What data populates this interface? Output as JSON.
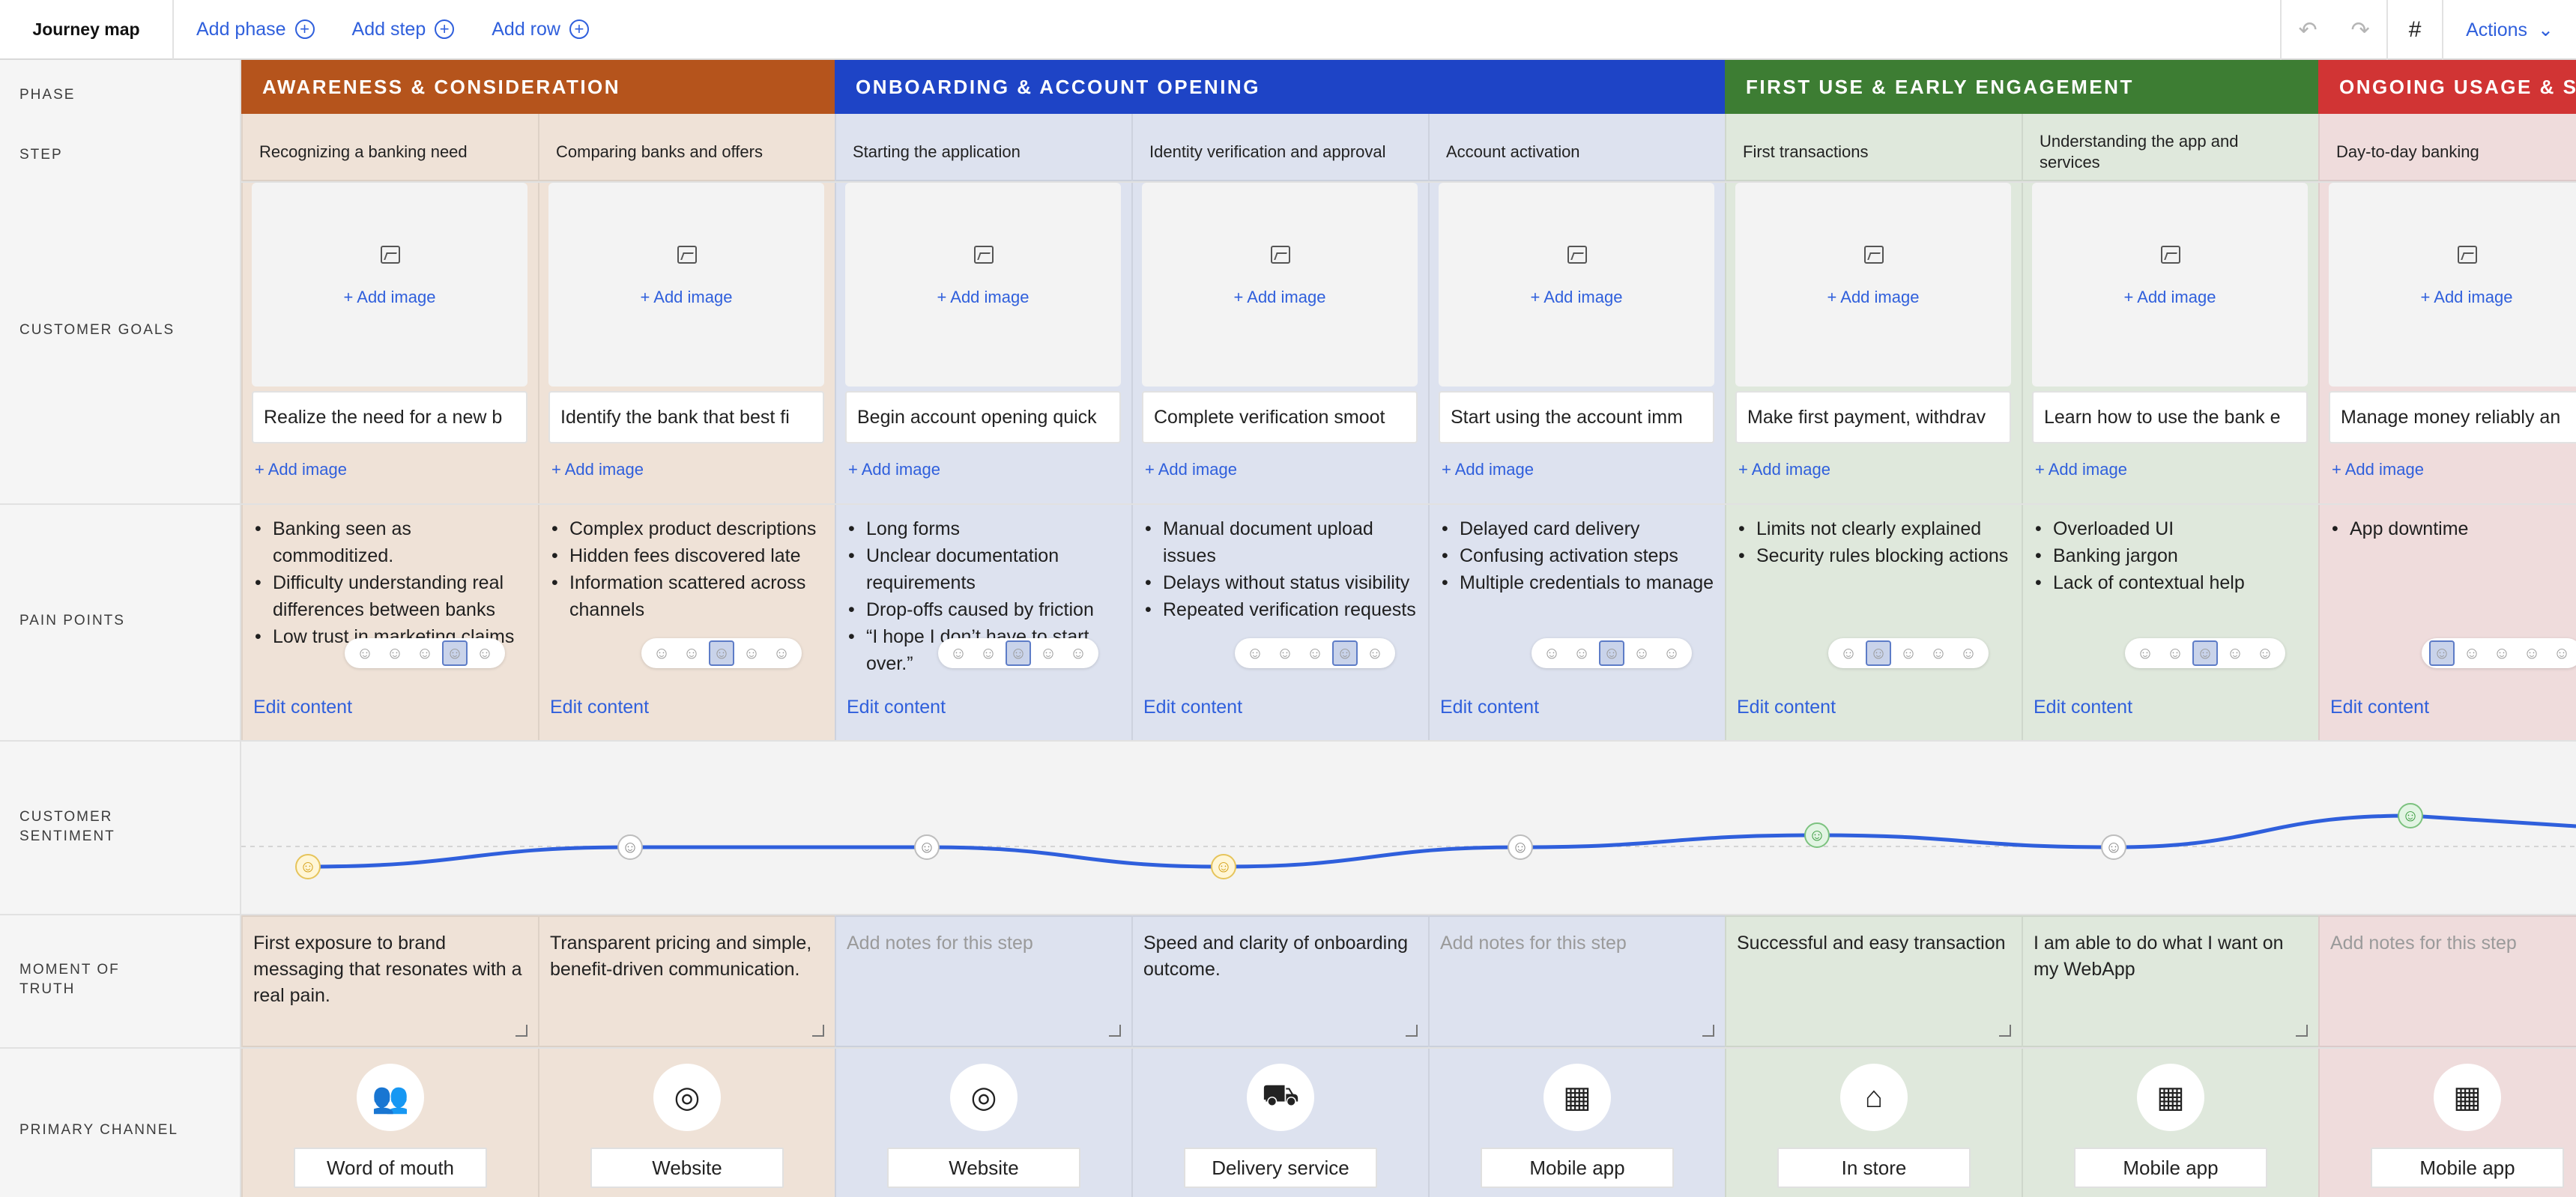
{
  "toolbar": {
    "title": "Journey map",
    "add_phase": "Add phase",
    "add_step": "Add step",
    "add_row": "Add row",
    "actions": "Actions"
  },
  "row_labels": {
    "phase": "PHASE",
    "step": "STEP",
    "customer_goals": "CUSTOMER GOALS",
    "pain_points": "PAIN POINTS",
    "customer_sentiment": "CUSTOMER SENTIMENT",
    "moment_of_truth": "MOMENT OF TRUTH",
    "primary_channel": "PRIMARY CHANNEL"
  },
  "phases": [
    {
      "name": "AWARENESS & CONSIDERATION",
      "color": "#b5541c"
    },
    {
      "name": "ONBOARDING & ACCOUNT OPENING",
      "color": "#1e44c6"
    },
    {
      "name": "FIRST USE & EARLY ENGAGEMENT",
      "color": "#3d7d33"
    },
    {
      "name": "ONGOING USAGE & SU",
      "color": "#d13434"
    }
  ],
  "common": {
    "add_image": "+ Add image",
    "edit_content": "Edit content"
  },
  "steps": [
    {
      "title": "Recognizing a banking need",
      "tint": "#efe2d7",
      "goal": "Realize the need for a new b",
      "pains": [
        "Banking seen as commoditized.",
        "Difficulty understanding real differences between banks",
        "Low trust in marketing claims"
      ],
      "moment": "First exposure to brand messaging that resonates with a real pain.",
      "moment_placeholder": false,
      "sentiment": "neutral-low",
      "channel_icon": "people-icon",
      "channel": "Word of mouth"
    },
    {
      "title": "Comparing banks and offers",
      "tint": "#efe2d7",
      "goal": "Identify the bank that best fi",
      "pains": [
        "Complex product descriptions",
        "Hidden fees discovered late",
        "Information scattered across channels"
      ],
      "moment": "Transparent pricing and simple, benefit-driven communication.",
      "moment_placeholder": false,
      "sentiment": "neutral",
      "channel_icon": "globe-icon",
      "channel": "Website"
    },
    {
      "title": "Starting the application",
      "tint": "#dde2ef",
      "goal": "Begin account opening quick",
      "pains": [
        "Long forms",
        "Unclear documentation requirements",
        "Drop-offs caused by friction",
        "“I hope I don’t have to start over.”"
      ],
      "moment": "Add notes for this step",
      "moment_placeholder": true,
      "sentiment": "neutral",
      "channel_icon": "globe-icon",
      "channel": "Website"
    },
    {
      "title": "Identity verification and approval",
      "tint": "#dde2ef",
      "goal": "Complete verification smoot",
      "pains": [
        "Manual document upload issues",
        "Delays without status visibility",
        "Repeated verification requests"
      ],
      "moment": "Speed and clarity of onboarding outcome.",
      "moment_placeholder": false,
      "sentiment": "neutral-low",
      "channel_icon": "truck-icon",
      "channel": "Delivery service"
    },
    {
      "title": "Account activation",
      "tint": "#dde2ef",
      "goal": "Start using the account imm",
      "pains": [
        "Delayed card delivery",
        "Confusing activation steps",
        "Multiple credentials to manage"
      ],
      "moment": "Add notes for this step",
      "moment_placeholder": true,
      "sentiment": "neutral",
      "channel_icon": "apps-icon",
      "channel": "Mobile app"
    },
    {
      "title": "First transactions",
      "tint": "#dfe8dc",
      "goal": "Make first payment, withdrav",
      "pains": [
        "Limits not clearly explained",
        "Security rules blocking actions"
      ],
      "moment": "Successful and easy transaction",
      "moment_placeholder": false,
      "sentiment": "positive",
      "channel_icon": "store-icon",
      "channel": "In store"
    },
    {
      "title": "Understanding the app and services",
      "tint": "#dfe8dc",
      "goal": "Learn how to use the bank e",
      "pains": [
        "Overloaded UI",
        "Banking jargon",
        "Lack of contextual help"
      ],
      "moment": "I am able to do what I want on my WebApp",
      "moment_placeholder": false,
      "sentiment": "neutral",
      "channel_icon": "apps-icon",
      "channel": "Mobile app"
    },
    {
      "title": "Day-to-day banking",
      "tint": "#efdcdc",
      "goal": "Manage money reliably an",
      "pains": [
        "App downtime"
      ],
      "moment": "Add notes for this step",
      "moment_placeholder": true,
      "sentiment": "very-positive",
      "channel_icon": "apps-icon",
      "channel": "Mobile app"
    }
  ]
}
